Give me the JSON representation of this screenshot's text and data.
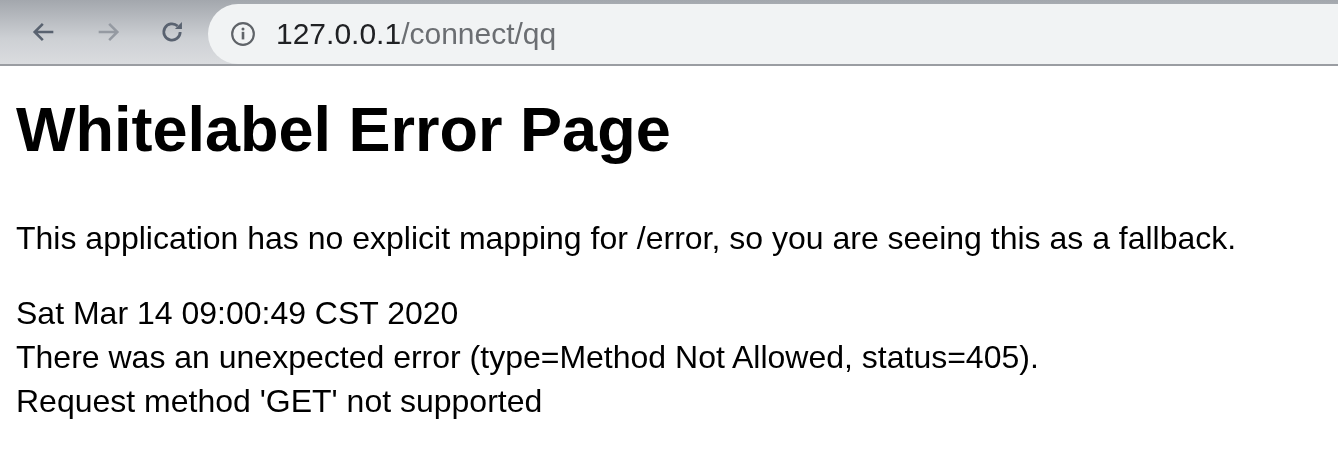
{
  "toolbar": {
    "back": {
      "disabled": false
    },
    "forward": {
      "disabled": true
    },
    "address": {
      "host": "127.0.0.1",
      "path": "/connect/qq"
    }
  },
  "page": {
    "title": "Whitelabel Error Page",
    "message": "This application has no explicit mapping for /error, so you are seeing this as a fallback.",
    "details": [
      "Sat Mar 14 09:00:49 CST 2020",
      "There was an unexpected error (type=Method Not Allowed, status=405).",
      "Request method 'GET' not supported"
    ]
  }
}
